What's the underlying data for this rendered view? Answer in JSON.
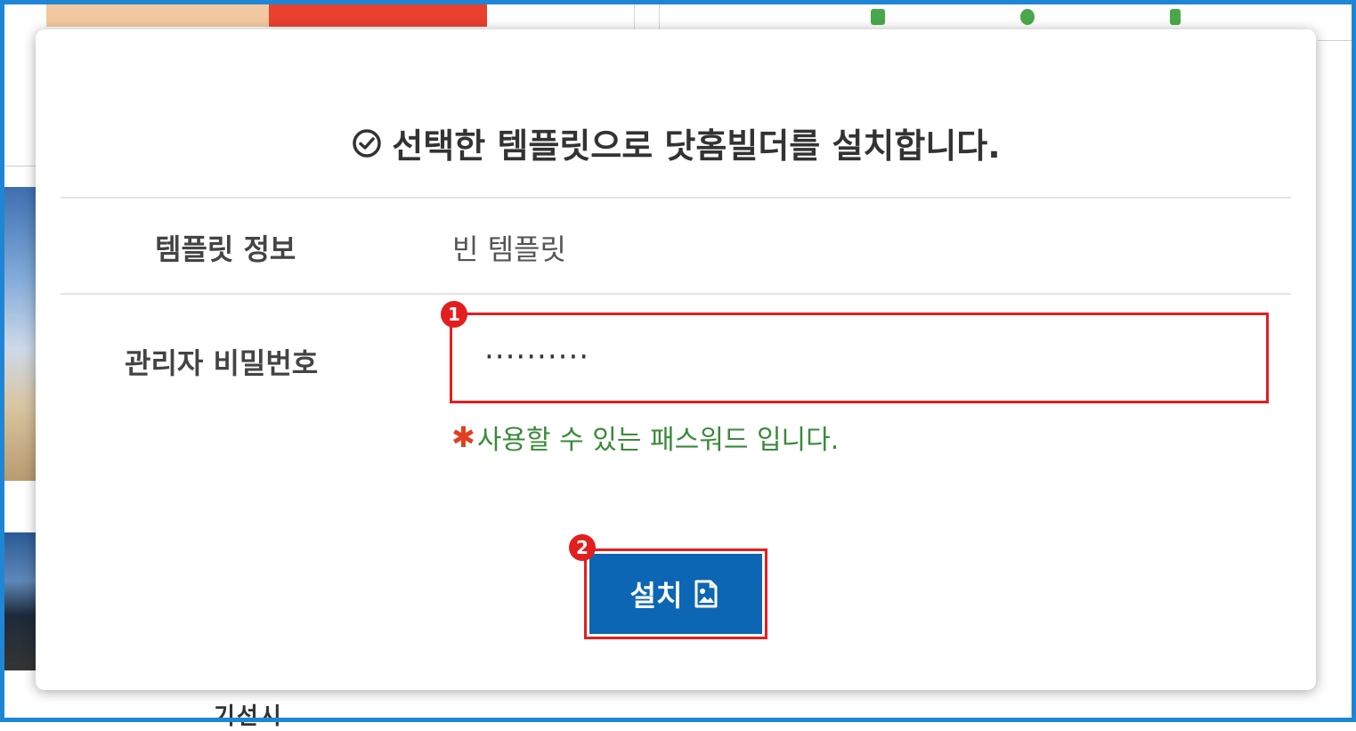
{
  "modal": {
    "title": "선택한 템플릿으로 닷홈빌더를 설치합니다.",
    "template_label": "템플릿 정보",
    "template_value": "빈 템플릿",
    "password_label": "관리자 비밀번호",
    "password_value": "··········",
    "password_hint": "사용할 수 있는 패스워드 입니다.",
    "hint_marker": "✱",
    "install_button_label": "설치"
  },
  "annotations": {
    "badge_1": "1",
    "badge_2": "2"
  },
  "background": {
    "partial_text": "기선시"
  },
  "colors": {
    "frame": "#1f86d6",
    "button": "#0d66b3",
    "highlight": "#e21f1f",
    "hint": "#3a8a3a"
  },
  "icons": {
    "title_icon": "check-circle-icon",
    "button_icon": "image-file-icon"
  }
}
